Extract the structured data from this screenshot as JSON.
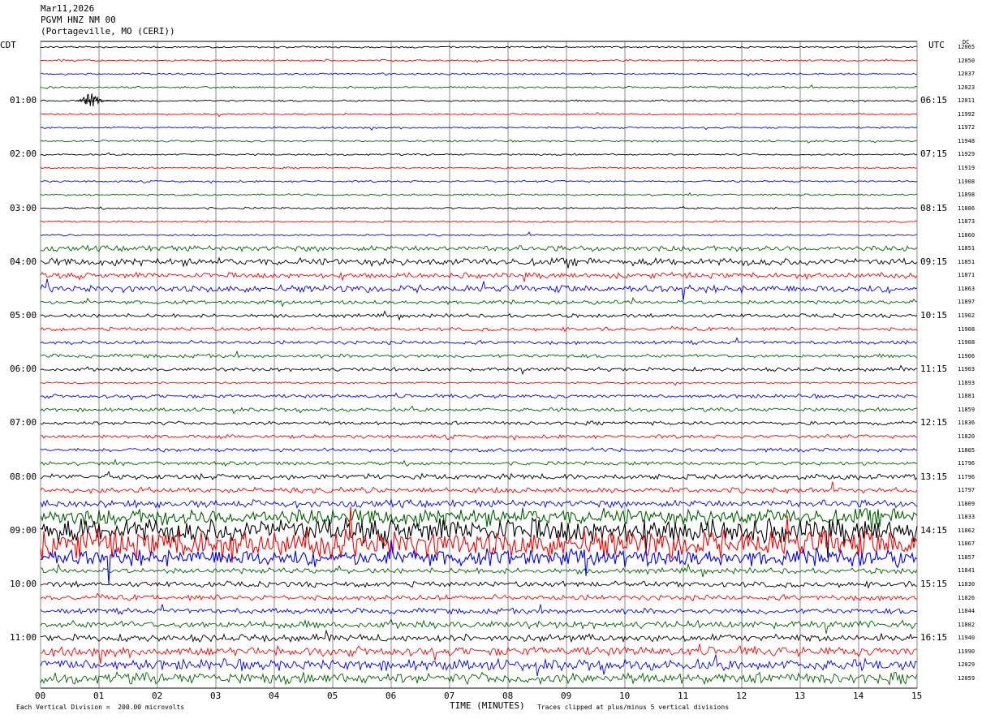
{
  "header": {
    "date": "Mar11,2026",
    "station": "PGVM HNZ NM 00",
    "location": "(Portageville, MO (CERI))"
  },
  "colors": {
    "trace_cycle": [
      "#000000",
      "#ff0000",
      "#0000ff",
      "#006400"
    ],
    "grid": "#888888"
  },
  "chart_data": {
    "type": "line",
    "subtype": "helicorder",
    "left_axis_label": "CDT",
    "right_axis_label": "UTC",
    "dc_label": "DC",
    "x_axis_label": "TIME (MINUTES)",
    "x_ticks": [
      "00",
      "01",
      "02",
      "03",
      "04",
      "05",
      "06",
      "07",
      "08",
      "09",
      "10",
      "11",
      "12",
      "13",
      "14",
      "15"
    ],
    "xlim": [
      0,
      15
    ],
    "grid": true,
    "row_count": 48,
    "left_hour_labels": [
      "01:00",
      "02:00",
      "03:00",
      "04:00",
      "05:00",
      "06:00",
      "07:00",
      "08:00",
      "09:00",
      "10:00",
      "11:00"
    ],
    "right_hour_labels": [
      "06:15",
      "07:15",
      "08:15",
      "09:15",
      "10:15",
      "11:15",
      "12:15",
      "13:15",
      "14:15",
      "15:15",
      "16:15"
    ],
    "dc_values": [
      "12065",
      "12050",
      "12037",
      "12023",
      "12011",
      "11992",
      "11972",
      "11948",
      "11929",
      "11919",
      "11908",
      "11898",
      "11886",
      "11873",
      "11860",
      "11851",
      "11851",
      "11871",
      "11863",
      "11897",
      "11902",
      "11908",
      "11908",
      "11906",
      "11903",
      "11893",
      "11881",
      "11859",
      "11836",
      "11820",
      "11805",
      "11796",
      "11796",
      "11797",
      "11809",
      "11833",
      "11862",
      "11867",
      "11857",
      "11841",
      "11830",
      "11826",
      "11844",
      "11882",
      "11940",
      "11990",
      "12029",
      "12059"
    ],
    "noise_level": [
      1,
      1,
      1,
      1,
      1,
      1,
      1,
      1,
      1,
      1,
      1,
      1,
      1,
      1,
      1,
      3,
      4,
      3,
      4,
      2,
      2,
      2,
      2,
      2,
      2,
      1,
      2,
      2,
      2,
      2,
      2,
      2,
      3,
      3,
      4,
      9,
      13,
      15,
      9,
      3,
      3,
      3,
      3,
      4,
      4,
      5,
      6,
      6
    ]
  },
  "footer": {
    "scale": "Each Vertical Division =  200.00 microvolts",
    "clip": "Traces clipped at plus/minus 5 vertical divisions"
  }
}
